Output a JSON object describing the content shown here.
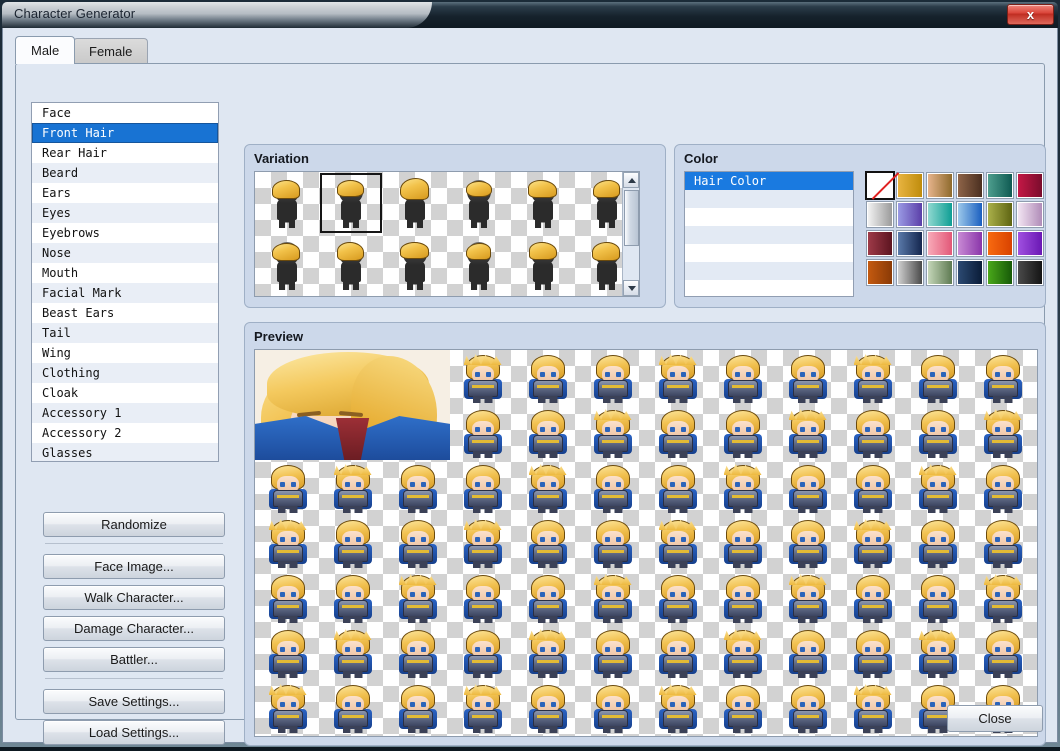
{
  "window": {
    "title": "Character Generator",
    "close_icon": "close-x-icon",
    "close_label": "x"
  },
  "tabs": [
    {
      "label": "Male",
      "active": true
    },
    {
      "label": "Female",
      "active": false
    }
  ],
  "parts_list": {
    "selected_index": 1,
    "items": [
      "Face",
      "Front Hair",
      "Rear Hair",
      "Beard",
      "Ears",
      "Eyes",
      "Eyebrows",
      "Nose",
      "Mouth",
      "Facial Mark",
      "Beast Ears",
      "Tail",
      "Wing",
      "Clothing",
      "Cloak",
      "Accessory 1",
      "Accessory 2",
      "Glasses"
    ]
  },
  "side_buttons": {
    "groups": [
      {
        "items": [
          "Randomize"
        ]
      },
      {
        "items": [
          "Face Image...",
          "Walk Character...",
          "Damage Character...",
          "Battler..."
        ]
      },
      {
        "items": [
          "Save Settings...",
          "Load Settings..."
        ]
      }
    ]
  },
  "variation": {
    "label": "Variation",
    "columns": 6,
    "rows": 2,
    "selected_index": 1,
    "count": 12,
    "scrollbar": {
      "up_icon": "scroll-up-arrow-icon",
      "down_icon": "scroll-down-arrow-icon",
      "thumb_position": "top"
    },
    "hair_shapes": [
      "swept-left",
      "short-parted",
      "spiky-tall",
      "bowl-short",
      "messy-fringe",
      "side-swept",
      "long-side",
      "layered-bob",
      "center-part",
      "curved-flip",
      "ponytail",
      "wavy-short"
    ]
  },
  "color": {
    "label": "Color",
    "list": {
      "selected_index": 0,
      "items": [
        "Hair Color",
        "",
        "",
        "",
        "",
        "",
        ""
      ]
    },
    "swatch_columns": 6,
    "swatch_rows": 4,
    "selected_swatch_index": 0,
    "swatches": [
      {
        "name": "none",
        "from": "#ffffff",
        "to": "#ffffff",
        "is_none": true
      },
      {
        "name": "gold",
        "from": "#e8b441",
        "to": "#bf8c0c"
      },
      {
        "name": "tan",
        "from": "#e6b48c",
        "to": "#8e6a2c"
      },
      {
        "name": "brown",
        "from": "#8e6448",
        "to": "#4a2f20"
      },
      {
        "name": "teal",
        "from": "#4e9e8e",
        "to": "#0e5a52"
      },
      {
        "name": "crimson",
        "from": "#c41846",
        "to": "#7a0c2c"
      },
      {
        "name": "silver",
        "from": "#f2f2f2",
        "to": "#9a9a9a"
      },
      {
        "name": "periwinkle",
        "from": "#9a9ae4",
        "to": "#5b3fa8"
      },
      {
        "name": "aqua",
        "from": "#8fd8d0",
        "to": "#0e9e94"
      },
      {
        "name": "sky-blue",
        "from": "#9cc8ea",
        "to": "#1a5fc0"
      },
      {
        "name": "olive",
        "from": "#aab04a",
        "to": "#5e6412"
      },
      {
        "name": "lilac",
        "from": "#f2e4f2",
        "to": "#b08cb8"
      },
      {
        "name": "maroon",
        "from": "#9e3a48",
        "to": "#5c1420"
      },
      {
        "name": "navy",
        "from": "#5a7aaa",
        "to": "#14264e"
      },
      {
        "name": "pink",
        "from": "#f8aab8",
        "to": "#e25878"
      },
      {
        "name": "orchid",
        "from": "#c88ad4",
        "to": "#8a36aa"
      },
      {
        "name": "orange",
        "from": "#f86a10",
        "to": "#d84200"
      },
      {
        "name": "violet",
        "from": "#a050e0",
        "to": "#6a18b4"
      },
      {
        "name": "rust",
        "from": "#c45a10",
        "to": "#8a3a06"
      },
      {
        "name": "grey",
        "from": "#cfcfcf",
        "to": "#4a4a4a"
      },
      {
        "name": "sage",
        "from": "#c4d6b8",
        "to": "#5e7a52"
      },
      {
        "name": "deep-blue",
        "from": "#2c4a72",
        "to": "#0a1c38"
      },
      {
        "name": "green",
        "from": "#4aa81a",
        "to": "#165a08"
      },
      {
        "name": "charcoal",
        "from": "#4a4a4a",
        "to": "#141414"
      }
    ]
  },
  "preview": {
    "label": "Preview",
    "columns": 12,
    "rows": 7,
    "face_portrait": {
      "name": "face-portrait",
      "hair": "blonde",
      "eyes": "blue",
      "outfit": "blue-and-red-uniform"
    },
    "sprite_count": 78,
    "sprite_description": "blonde knight chibi in blue cape and silver armor"
  },
  "bottom": {
    "close_label": "Close"
  }
}
